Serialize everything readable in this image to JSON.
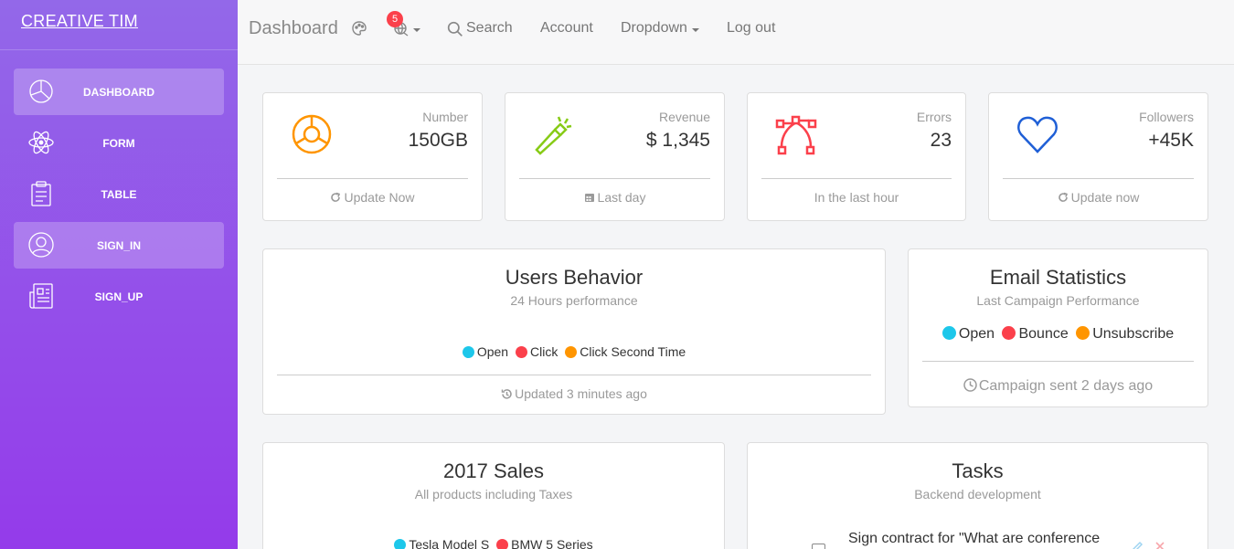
{
  "colors": {
    "sidebar_top": "#9368e9",
    "sidebar_bottom": "#943bea",
    "badge": "#fb404b",
    "info": "#1dc7ea",
    "danger": "#fb404b",
    "warning": "#ff9500",
    "success": "#87cb16",
    "primary": "#1f5fd6"
  },
  "sidebar": {
    "brand": "CREATIVE TIM",
    "items": [
      {
        "label": "DASHBOARD",
        "icon": "pie-chart-icon",
        "active": true
      },
      {
        "label": "FORM",
        "icon": "atom-icon",
        "active": false
      },
      {
        "label": "TABLE",
        "icon": "clipboard-icon",
        "active": false
      },
      {
        "label": "SIGN_IN",
        "icon": "user-circle-icon",
        "active": true
      },
      {
        "label": "SIGN_UP",
        "icon": "newspaper-icon",
        "active": false
      }
    ]
  },
  "topbar": {
    "title": "Dashboard",
    "notification_count": "5",
    "search_label": "Search",
    "account_label": "Account",
    "dropdown_label": "Dropdown",
    "logout_label": "Log out"
  },
  "stats": [
    {
      "category": "Number",
      "value": "150GB",
      "footer": "Update Now",
      "icon": "chart-circle-icon",
      "footer_icon": "refresh-icon"
    },
    {
      "category": "Revenue",
      "value": "$ 1,345",
      "footer": "Last day",
      "icon": "flashlight-icon",
      "footer_icon": "calendar-icon"
    },
    {
      "category": "Errors",
      "value": "23",
      "footer": "In the last hour",
      "icon": "vector-icon",
      "footer_icon": ""
    },
    {
      "category": "Followers",
      "value": "+45K",
      "footer": "Update now",
      "icon": "heart-icon",
      "footer_icon": "refresh-icon"
    }
  ],
  "users_behavior": {
    "title": "Users Behavior",
    "subtitle": "24 Hours performance",
    "legend": [
      "Open",
      "Click",
      "Click Second Time"
    ],
    "footer": "Updated 3 minutes ago"
  },
  "email_statistics": {
    "title": "Email Statistics",
    "subtitle": "Last Campaign Performance",
    "legend": [
      "Open",
      "Bounce",
      "Unsubscribe"
    ],
    "footer": "Campaign sent 2 days ago"
  },
  "sales": {
    "title": "2017 Sales",
    "subtitle": "All products including Taxes",
    "legend": [
      "Tesla Model S",
      "BMW 5 Series"
    ]
  },
  "tasks": {
    "title": "Tasks",
    "subtitle": "Backend development",
    "items": [
      "Sign contract for \"What are conference"
    ]
  }
}
